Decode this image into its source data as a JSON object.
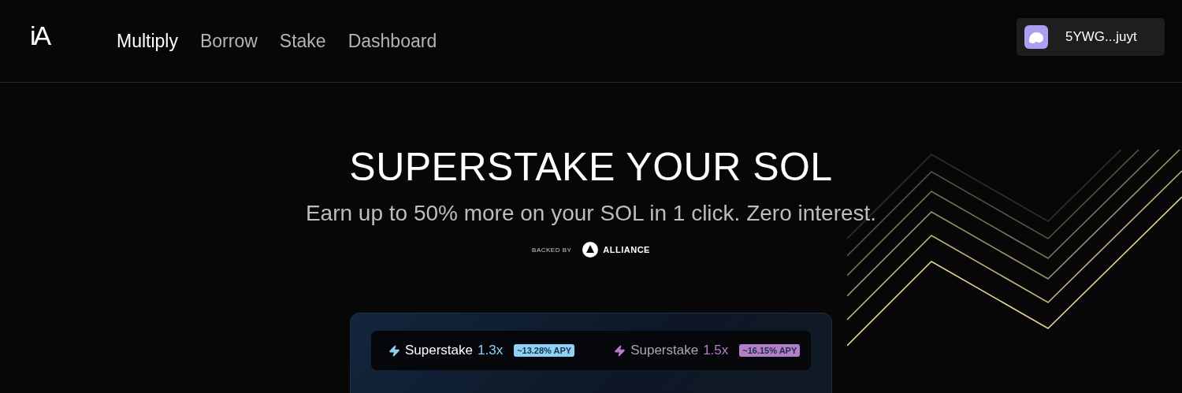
{
  "logo": "iA",
  "nav": [
    {
      "label": "Multiply",
      "selected": true
    },
    {
      "label": "Borrow",
      "selected": false
    },
    {
      "label": "Stake",
      "selected": false
    },
    {
      "label": "Dashboard",
      "selected": false
    }
  ],
  "wallet": {
    "address": "5YWG...juyt"
  },
  "hero": {
    "title": "SUPERSTAKE YOUR SOL",
    "subtitle": "Earn up to 50% more on your SOL in 1 click. Zero interest.",
    "backed_by": "BACKED BY",
    "partner": "ALLIANCE"
  },
  "card": {
    "options": [
      {
        "label": "Superstake",
        "multiplier": "1.3x",
        "apy": "~13.28% APY",
        "selected": true,
        "color": "#8fd0f5"
      },
      {
        "label": "Superstake",
        "multiplier": "1.5x",
        "apy": "~16.15% APY",
        "selected": false,
        "color": "#b57ec9"
      }
    ]
  }
}
